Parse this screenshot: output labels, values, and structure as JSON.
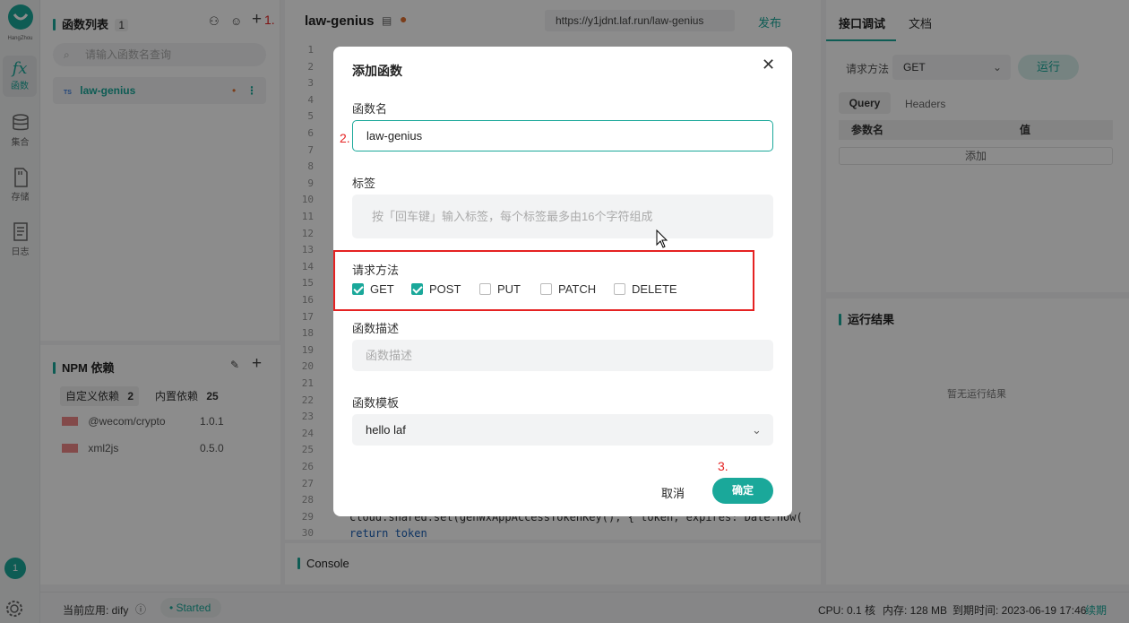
{
  "rail": {
    "region": "HangZhou",
    "items": [
      {
        "icon": "function-icon",
        "label": "函数"
      },
      {
        "icon": "database-icon",
        "label": "集合"
      },
      {
        "icon": "storage-icon",
        "label": "存储"
      },
      {
        "icon": "log-icon",
        "label": "日志"
      }
    ],
    "badge": "1"
  },
  "fn_panel": {
    "title": "函数列表",
    "count": "1",
    "search_placeholder": "请输入函数名查询",
    "items": [
      {
        "lang": "TS",
        "name": "law-genius"
      }
    ]
  },
  "npm": {
    "title": "NPM 依赖",
    "tab_custom": "自定义依赖",
    "tab_custom_count": "2",
    "tab_builtin": "内置依赖",
    "tab_builtin_count": "25",
    "packages": [
      {
        "name": "@wecom/crypto",
        "version": "1.0.1"
      },
      {
        "name": "xml2js",
        "version": "0.5.0"
      }
    ]
  },
  "editor": {
    "title": "law-genius",
    "url": "https://y1jdnt.laf.run/law-genius",
    "publish": "发布",
    "line_numbers": [
      "1",
      "2",
      "3",
      "4",
      "5",
      "6",
      "7",
      "8",
      "9",
      "10",
      "11",
      "12",
      "13",
      "14",
      "15",
      "16",
      "17",
      "18",
      "19",
      "20",
      "21",
      "22",
      "23",
      "24",
      "25",
      "26",
      "27",
      "28",
      "29",
      "30"
    ],
    "code_line_29": "cloud.shared.set(genWxAppAccessTokenKey(), { token, expires: Date.now(",
    "code_line_30": "return token"
  },
  "console": {
    "title": "Console"
  },
  "debug": {
    "tab_debug": "接口调试",
    "tab_docs": "文档",
    "method_label": "请求方法",
    "method_value": "GET",
    "run": "运行",
    "tab_query": "Query",
    "tab_headers": "Headers",
    "col_param": "参数名",
    "col_value": "值",
    "add": "添加"
  },
  "result": {
    "title": "运行结果",
    "empty": "暂无运行结果"
  },
  "status": {
    "app": "当前应用: dify",
    "started": "Started",
    "cpu": "CPU: 0.1 核",
    "memory": "内存: 128 MB",
    "expire": "到期时间: 2023-06-19 17:46",
    "renew": "续期"
  },
  "modal": {
    "title": "添加函数",
    "name_label": "函数名",
    "name_value": "law-genius",
    "tag_label": "标签",
    "tag_placeholder": "按「回车键」输入标签，每个标签最多由16个字符组成",
    "method_label": "请求方法",
    "methods": [
      {
        "name": "GET",
        "checked": true
      },
      {
        "name": "POST",
        "checked": true
      },
      {
        "name": "PUT",
        "checked": false
      },
      {
        "name": "PATCH",
        "checked": false
      },
      {
        "name": "DELETE",
        "checked": false
      }
    ],
    "desc_label": "函数描述",
    "desc_placeholder": "函数描述",
    "template_label": "函数模板",
    "template_value": "hello laf",
    "cancel": "取消",
    "confirm": "确定"
  },
  "annotations": {
    "a1": "1.",
    "a2": "2.",
    "a3": "3."
  },
  "colors": {
    "accent": "#1aa89a",
    "annotation": "#e52222"
  }
}
